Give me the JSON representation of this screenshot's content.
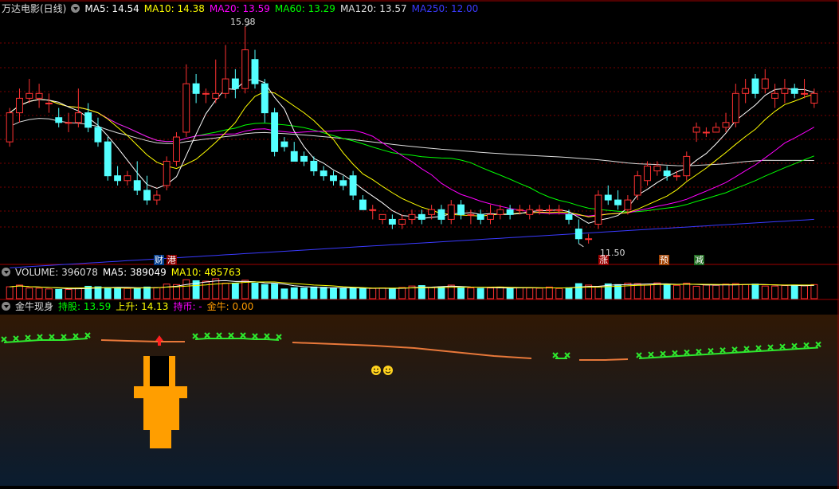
{
  "colors": {
    "up": "#ff3232",
    "down": "#54ffff",
    "ma5": "#ffffff",
    "ma10": "#ffff00",
    "ma20": "#ff00ff",
    "ma60": "#00ff00",
    "ma120": "#dddddd",
    "ma250": "#3a3aff",
    "grid": "#7a0000"
  },
  "header": {
    "title": "万达电影(日线)",
    "ma5": "MA5: 14.54",
    "ma10": "MA10: 14.38",
    "ma20": "MA20: 13.59",
    "ma60": "MA60: 13.29",
    "ma120": "MA120: 13.57",
    "ma250": "MA250: 12.00"
  },
  "annotations": {
    "high": "15.98",
    "low": "11.50"
  },
  "markers": {
    "cai": "财",
    "gang": "港",
    "zhang": "涨",
    "yu": "预",
    "jian": "减"
  },
  "volume_header": {
    "label": "VOLUME: 396078",
    "ma5": "MA5: 389049",
    "ma10": "MA10: 485763"
  },
  "indicator_header": {
    "name": "金牛现身",
    "chigu": "持股: 13.59",
    "shangsheng": "上升: 14.13",
    "chibi": "持币: -",
    "jinniu": "金牛: 0.00"
  },
  "icons": {
    "smile": "smiley-icon",
    "arrow": "up-arrow-icon"
  },
  "chart_data": {
    "type": "candlestick",
    "title": "万达电影(日线)",
    "ohlc": [
      [
        13.6,
        14.3,
        13.5,
        14.2
      ],
      [
        14.2,
        14.7,
        14.0,
        14.5
      ],
      [
        14.5,
        14.9,
        14.4,
        14.6
      ],
      [
        14.5,
        14.8,
        14.3,
        14.6
      ],
      [
        14.4,
        14.6,
        14.2,
        14.4
      ],
      [
        14.1,
        14.3,
        13.9,
        14.0
      ],
      [
        14.0,
        14.2,
        13.8,
        14.0
      ],
      [
        14.0,
        14.7,
        13.9,
        14.2
      ],
      [
        14.2,
        14.4,
        13.8,
        13.9
      ],
      [
        13.9,
        14.1,
        13.5,
        13.6
      ],
      [
        13.6,
        13.7,
        12.8,
        12.9
      ],
      [
        12.9,
        13.1,
        12.7,
        12.8
      ],
      [
        12.8,
        13.0,
        12.7,
        12.9
      ],
      [
        12.8,
        13.2,
        12.5,
        12.6
      ],
      [
        12.6,
        12.9,
        12.3,
        12.4
      ],
      [
        12.4,
        12.6,
        12.3,
        12.5
      ],
      [
        12.7,
        13.3,
        12.6,
        13.2
      ],
      [
        13.2,
        13.8,
        13.1,
        13.7
      ],
      [
        13.8,
        15.2,
        13.7,
        14.8
      ],
      [
        14.8,
        15.0,
        14.4,
        14.6
      ],
      [
        14.6,
        14.7,
        14.4,
        14.6
      ],
      [
        14.5,
        15.3,
        14.4,
        14.6
      ],
      [
        14.6,
        15.6,
        14.5,
        14.9
      ],
      [
        14.9,
        15.1,
        14.5,
        14.7
      ],
      [
        14.7,
        15.98,
        14.6,
        15.5
      ],
      [
        15.3,
        15.5,
        14.7,
        14.8
      ],
      [
        14.8,
        14.9,
        14.0,
        14.2
      ],
      [
        14.2,
        14.3,
        13.3,
        13.4
      ],
      [
        13.6,
        13.7,
        13.4,
        13.5
      ],
      [
        13.4,
        13.6,
        13.2,
        13.2
      ],
      [
        13.3,
        13.4,
        13.1,
        13.2
      ],
      [
        13.2,
        13.3,
        12.9,
        13.0
      ],
      [
        13.0,
        13.1,
        12.8,
        12.9
      ],
      [
        12.9,
        13.0,
        12.7,
        12.8
      ],
      [
        12.8,
        12.9,
        12.6,
        12.7
      ],
      [
        12.9,
        13.0,
        12.4,
        12.5
      ],
      [
        12.4,
        12.5,
        12.2,
        12.2
      ],
      [
        12.2,
        12.3,
        12.0,
        12.2
      ],
      [
        12.0,
        12.1,
        11.9,
        12.1
      ],
      [
        12.0,
        12.1,
        11.8,
        11.9
      ],
      [
        11.9,
        12.1,
        11.8,
        12.0
      ],
      [
        12.0,
        12.2,
        11.9,
        12.1
      ],
      [
        12.1,
        12.2,
        11.9,
        12.0
      ],
      [
        12.1,
        12.3,
        12.0,
        12.2
      ],
      [
        12.2,
        12.3,
        11.9,
        12.0
      ],
      [
        12.0,
        12.4,
        11.9,
        12.3
      ],
      [
        12.3,
        12.4,
        12.0,
        12.1
      ],
      [
        12.1,
        12.2,
        11.9,
        12.1
      ],
      [
        12.1,
        12.2,
        11.9,
        12.0
      ],
      [
        12.0,
        12.3,
        11.9,
        12.1
      ],
      [
        12.1,
        12.3,
        12.0,
        12.2
      ],
      [
        12.2,
        12.3,
        12.0,
        12.1
      ],
      [
        12.2,
        12.3,
        12.1,
        12.2
      ],
      [
        12.1,
        12.3,
        12.0,
        12.2
      ],
      [
        12.2,
        12.3,
        12.1,
        12.2
      ],
      [
        12.2,
        12.3,
        12.1,
        12.2
      ],
      [
        12.2,
        12.3,
        12.1,
        12.2
      ],
      [
        12.1,
        12.2,
        11.9,
        12.0
      ],
      [
        11.8,
        12.0,
        11.5,
        11.6
      ],
      [
        11.6,
        11.7,
        11.5,
        11.6
      ],
      [
        11.9,
        12.6,
        11.8,
        12.5
      ],
      [
        12.5,
        12.7,
        12.3,
        12.4
      ],
      [
        12.4,
        12.6,
        12.2,
        12.3
      ],
      [
        12.2,
        12.5,
        12.1,
        12.4
      ],
      [
        12.5,
        13.0,
        12.4,
        12.9
      ],
      [
        12.8,
        13.2,
        12.7,
        13.1
      ],
      [
        13.0,
        13.2,
        12.9,
        13.1
      ],
      [
        13.0,
        13.1,
        12.8,
        12.9
      ],
      [
        12.9,
        13.0,
        12.8,
        12.9
      ],
      [
        12.9,
        13.4,
        12.8,
        13.3
      ],
      [
        13.8,
        14.0,
        13.6,
        13.9
      ],
      [
        13.8,
        13.9,
        13.7,
        13.8
      ],
      [
        13.8,
        14.0,
        13.8,
        13.9
      ],
      [
        13.9,
        14.2,
        13.8,
        14.0
      ],
      [
        14.0,
        14.8,
        13.9,
        14.6
      ],
      [
        14.6,
        14.9,
        14.4,
        14.7
      ],
      [
        14.9,
        15.0,
        14.5,
        14.6
      ],
      [
        14.7,
        15.1,
        14.6,
        14.9
      ],
      [
        14.5,
        14.8,
        14.3,
        14.6
      ],
      [
        14.6,
        14.9,
        14.4,
        14.7
      ],
      [
        14.7,
        14.8,
        14.5,
        14.6
      ],
      [
        14.6,
        14.9,
        14.5,
        14.6
      ],
      [
        14.4,
        14.7,
        14.3,
        14.6
      ]
    ],
    "volume": [
      49,
      56,
      44,
      43,
      40,
      38,
      38,
      44,
      51,
      49,
      46,
      45,
      42,
      44,
      48,
      46,
      60,
      58,
      78,
      74,
      72,
      82,
      64,
      62,
      76,
      64,
      58,
      60,
      40,
      45,
      44,
      48,
      47,
      43,
      42,
      44,
      42,
      42,
      44,
      40,
      46,
      52,
      54,
      46,
      49,
      56,
      44,
      44,
      42,
      44,
      48,
      42,
      45,
      44,
      43,
      48,
      42,
      45,
      62,
      56,
      50,
      61,
      58,
      64,
      62,
      56,
      65,
      58,
      55,
      64,
      51,
      56,
      55,
      60,
      62,
      58,
      60,
      52,
      52,
      54,
      56,
      53,
      58
    ],
    "ma250_range": [
      11.0,
      12.0
    ]
  },
  "indicator": {
    "smile_count": 2
  }
}
